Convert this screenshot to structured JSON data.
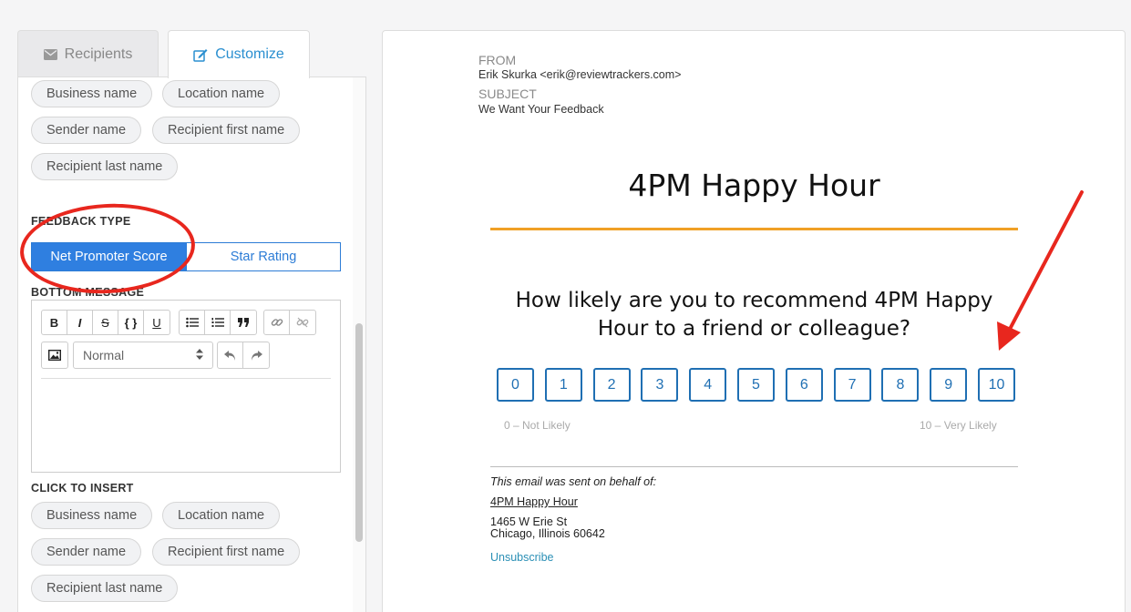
{
  "tabs": [
    {
      "label": "Recipients",
      "icon": "envelope-icon",
      "active": false
    },
    {
      "label": "Customize",
      "icon": "edit-icon",
      "active": true
    }
  ],
  "insert_chips_top": [
    "Business name",
    "Location name",
    "Sender name",
    "Recipient first name",
    "Recipient last name"
  ],
  "feedback_type": {
    "label": "FEEDBACK TYPE",
    "options": [
      "Net Promoter Score",
      "Star Rating"
    ],
    "selected": "Net Promoter Score"
  },
  "bottom_message": {
    "label": "BOTTOM MESSAGE",
    "toolbar": [
      "B",
      "I",
      "S",
      "{ }",
      "U"
    ],
    "format_select": "Normal"
  },
  "click_to_insert": {
    "label": "CLICK TO INSERT",
    "chips": [
      "Business name",
      "Location name",
      "Sender name",
      "Recipient first name",
      "Recipient last name"
    ]
  },
  "preview": {
    "from_label": "FROM",
    "from_value": "Erik Skurka <erik@reviewtrackers.com>",
    "subject_label": "SUBJECT",
    "subject_value": "We Want Your Feedback",
    "title": "4PM Happy Hour",
    "question": "How likely are you to recommend 4PM Happy Hour to a friend or colleague?",
    "scores": [
      "0",
      "1",
      "2",
      "3",
      "4",
      "5",
      "6",
      "7",
      "8",
      "9",
      "10"
    ],
    "low_label": "0 – Not Likely",
    "high_label": "10 – Very Likely",
    "sent_on_behalf": "This email was sent on behalf of:",
    "business_link": "4PM Happy Hour",
    "address_line1": "1465 W Erie St",
    "address_line2": "Chicago, Illinois 60642",
    "unsubscribe": "Unsubscribe"
  },
  "colors": {
    "accent_blue": "#2f7fe0",
    "link_blue": "#2a8fd0",
    "score_blue": "#1f6fb3",
    "orange_rule": "#f0a026",
    "annotation_red": "#e8271e"
  }
}
